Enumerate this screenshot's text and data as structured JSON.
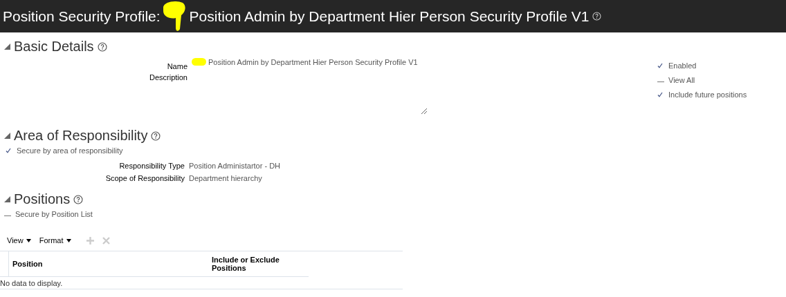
{
  "header": {
    "title": "Position Security Profile:",
    "name": "Position Admin by Department Hier Person Security Profile V1"
  },
  "basic_details": {
    "title": "Basic Details",
    "fields": [
      {
        "label": "Name",
        "value": "Position Admin by Department Hier Person Security Profile V1"
      },
      {
        "label": "Description"
      }
    ],
    "options": [
      {
        "label": "Enabled",
        "checked": true
      },
      {
        "label": "View All",
        "checked": false
      },
      {
        "label": "Include future positions",
        "checked": true
      }
    ]
  },
  "area_of_responsibility": {
    "title": "Area of Responsibility",
    "option": {
      "label": "Secure by area of responsibility",
      "checked": true
    },
    "fields": [
      {
        "label": "Responsibility Type",
        "value": "Position Administartor - DH"
      },
      {
        "label": "Scope of Responsibility",
        "value": "Department hierarchy"
      }
    ]
  },
  "positions": {
    "title": "Positions",
    "option": {
      "label": "Secure by Position List",
      "checked": false
    },
    "toolbar": [
      {
        "label": "View"
      },
      {
        "label": "Format"
      }
    ],
    "table": {
      "columns": [
        "Position",
        "Include or Exclude Positions"
      ],
      "empty_text": "No data to display."
    }
  }
}
